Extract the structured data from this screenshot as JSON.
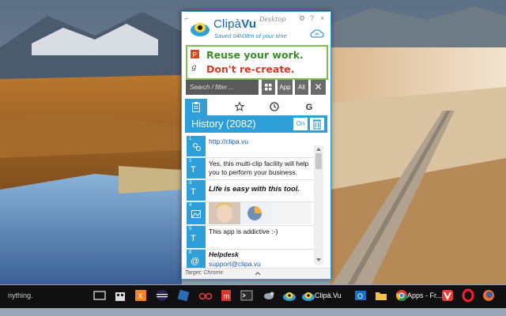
{
  "clipavu": {
    "brand_prefix": "Clipà",
    "brand_suffix": "Vu",
    "edition": "Desktop",
    "saved_time": "Saved 04h08m of your time",
    "window_buttons": [
      "⚙",
      "?",
      "×"
    ],
    "banner_line1": "Reuse your work.",
    "banner_line2": "Don't re-create.",
    "search_placeholder": "Search / filter ...",
    "filter_buttons": {
      "app": "App",
      "all": "All"
    },
    "tabs": [
      "clipboard",
      "favorites",
      "recent",
      "google"
    ],
    "tab_g_label": "G",
    "history_title": "History (2082)",
    "history_toggle": "On",
    "items": [
      {
        "num": "1",
        "key": "",
        "text": "http://clipa.vu",
        "style": "link"
      },
      {
        "num": "2",
        "key": "T",
        "text": "Yes, this multi-clip facility will help you to perform your business.",
        "style": "plain"
      },
      {
        "num": "3",
        "key": "T",
        "text": "Life is easy with this tool.",
        "style": "italic-bold"
      },
      {
        "num": "4",
        "key": "",
        "text": "",
        "style": "image"
      },
      {
        "num": "5",
        "key": "T",
        "text": "This app is addictive :-)",
        "style": "plain"
      },
      {
        "num": "6",
        "key": "@",
        "text_line1": "Helpdesk",
        "text_line2": "support@clipa.vu",
        "style": "contact"
      }
    ],
    "status": "Target: Chrome"
  },
  "taskbar": {
    "search_hint": "nything.",
    "clipavu_label": "Clipà.Vu",
    "apps_label": "Apps - Fr..."
  },
  "colors": {
    "accent": "#2e9fd9",
    "banner_green": "#3b8d2a",
    "banner_red": "#d43a2a",
    "taskbar": "#101010"
  }
}
